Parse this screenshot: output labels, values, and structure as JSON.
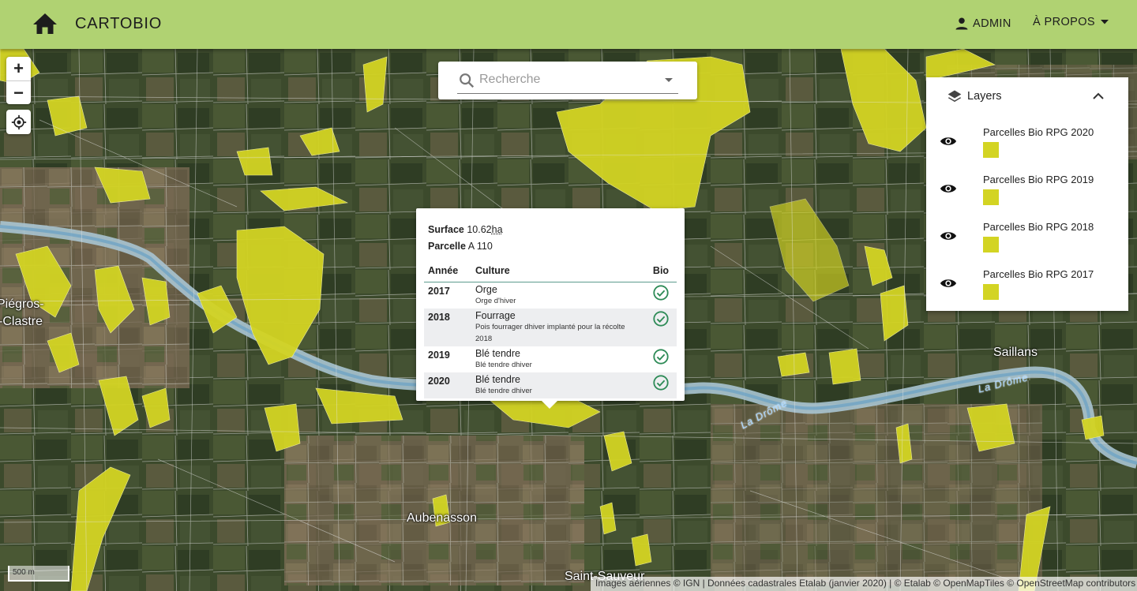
{
  "header": {
    "brand": "CARTOBIO",
    "admin_label": "ADMIN",
    "about_label": "À PROPOS"
  },
  "search": {
    "placeholder": "Recherche"
  },
  "layers": {
    "title": "Layers",
    "items": [
      {
        "label": "Parcelles Bio RPG 2020"
      },
      {
        "label": "Parcelles Bio RPG 2019"
      },
      {
        "label": "Parcelles Bio RPG 2018"
      },
      {
        "label": "Parcelles Bio RPG 2017"
      }
    ]
  },
  "popup": {
    "surface_label": "Surface",
    "surface_value": "10.62",
    "surface_unit": "ha",
    "parcelle_label": "Parcelle",
    "parcelle_value": "A 110",
    "columns": {
      "year": "Année",
      "culture": "Culture",
      "bio": "Bio"
    },
    "rows": [
      {
        "year": "2017",
        "culture": "Orge",
        "detail": "Orge d'hiver"
      },
      {
        "year": "2018",
        "culture": "Fourrage",
        "detail": "Pois fourrager dhiver implanté pour la récolte 2018"
      },
      {
        "year": "2019",
        "culture": "Blé tendre",
        "detail": "Blé tendre dhiver"
      },
      {
        "year": "2020",
        "culture": "Blé tendre",
        "detail": "Blé tendre dhiver"
      }
    ]
  },
  "map": {
    "labels": {
      "piegros_1": "Piégros-",
      "piegros_2": "-Clastre",
      "saillans": "Saillans",
      "aubenasson": "Aubenasson",
      "saint_sauveur": "Saint-Sauveur",
      "drome_1": "La Drôme",
      "drome_2": "La Drôme"
    },
    "scale": "500 m",
    "attribution": "Images aériennes © IGN | Données cadastrales Etalab (janvier 2020) | © Etalab © OpenMapTiles © OpenStreetMap contributors"
  },
  "colors": {
    "header_bg": "#b0d272",
    "parcel_fill": "#d3d423",
    "bio_check": "#2e8b57"
  }
}
